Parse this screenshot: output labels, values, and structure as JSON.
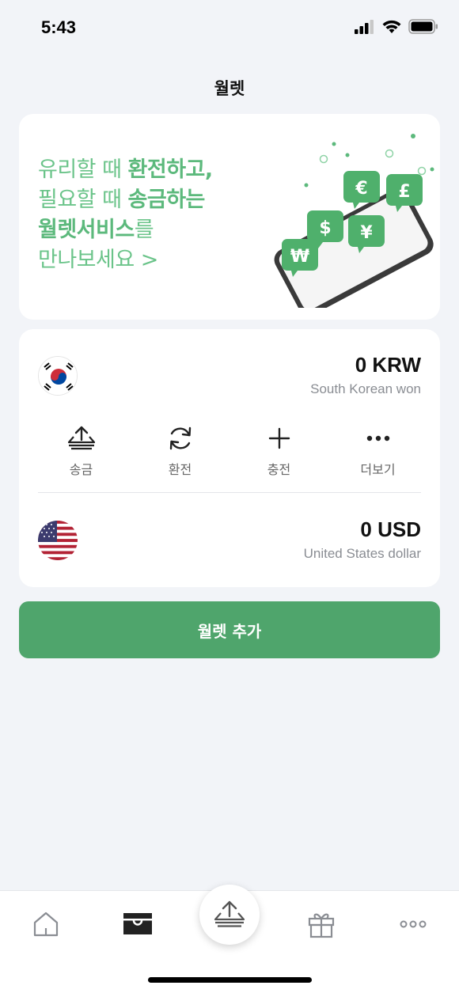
{
  "status": {
    "time": "5:43"
  },
  "header": {
    "title": "월렛"
  },
  "banner": {
    "line1_plain": "유리할 때 ",
    "line1_bold": "환전하고,",
    "line2_plain": "필요할 때 ",
    "line2_bold": "송금하는",
    "line3_bold": "월렛서비스",
    "line3_plain": "를",
    "line4": "만나보세요  >",
    "currency_symbols": [
      "€",
      "£",
      "$",
      "¥",
      "₩"
    ]
  },
  "wallets": [
    {
      "flag": "south-korea-flag",
      "amount": "0 KRW",
      "name": "South Korean won"
    },
    {
      "flag": "united-states-flag",
      "amount": "0 USD",
      "name": "United States dollar"
    }
  ],
  "actions": [
    {
      "icon": "send-tray-icon",
      "label": "송금"
    },
    {
      "icon": "exchange-refresh-icon",
      "label": "환전"
    },
    {
      "icon": "plus-icon",
      "label": "충전"
    },
    {
      "icon": "more-dots-icon",
      "label": "더보기"
    }
  ],
  "add_wallet_label": "월렛 추가",
  "tabs": [
    {
      "icon": "home-icon"
    },
    {
      "icon": "wallet-icon"
    },
    {
      "icon": "send-icon"
    },
    {
      "icon": "gift-icon"
    },
    {
      "icon": "more-icon"
    }
  ],
  "colors": {
    "accent": "#4fa56c",
    "banner_text": "#6bc48a",
    "background": "#f2f4f8"
  }
}
